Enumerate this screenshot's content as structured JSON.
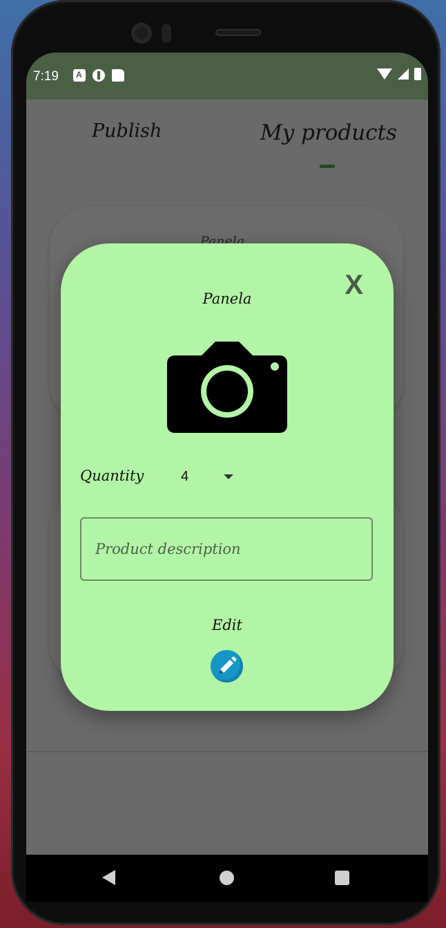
{
  "status_bar": {
    "time": "7:19",
    "left_icons": [
      "accessibility-a-icon",
      "circle-app-icon",
      "sd-card-icon"
    ],
    "right_icons": [
      "wifi-icon",
      "signal-icon",
      "battery-icon"
    ]
  },
  "tabs": [
    {
      "label": "Publish",
      "selected": false
    },
    {
      "label": "My products",
      "selected": true
    }
  ],
  "background_cards": [
    {
      "title": "Panela"
    },
    {
      "title": ""
    }
  ],
  "dialog": {
    "title": "Panela",
    "close_label": "X",
    "photo_icon": "camera-icon",
    "quantity_label": "Quantity",
    "quantity_value": "4",
    "description_placeholder": "Product description",
    "edit_label": "Edit",
    "edit_icon": "pencil-icon"
  },
  "colors": {
    "status_bar": "#4b5f45",
    "dialog_bg": "#b3f5a6",
    "tab_indicator": "#1f4f1f",
    "edit_button": "#1596c7",
    "scrim": "#6a6a6a"
  },
  "nav_bar": [
    "back-icon",
    "home-icon",
    "recents-icon"
  ]
}
